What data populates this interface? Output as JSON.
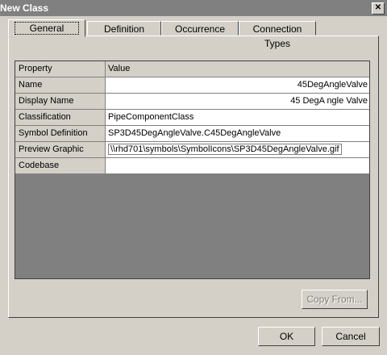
{
  "window": {
    "title": "New Class",
    "close_icon": "close-icon"
  },
  "tabs": [
    {
      "label": "General",
      "active": true
    },
    {
      "label": "Definition",
      "active": false
    },
    {
      "label": "Occurrence",
      "active": false
    },
    {
      "label": "Connection Types",
      "active": false
    }
  ],
  "grid": {
    "header": {
      "property": "Property",
      "value": "Value"
    },
    "rows": [
      {
        "property": "Name",
        "value": "45DegAngleValve"
      },
      {
        "property": "Display Name",
        "value": "45 DegA ngle Valve"
      },
      {
        "property": "Classification",
        "value": "PipeComponentClass"
      },
      {
        "property": "Symbol Definition",
        "value": "SP3D45DegAngleValve.C45DegAngleValve"
      },
      {
        "property": "Preview Graphic",
        "value": "\\\\rhd701\\symbols\\SymbolIcons\\SP3D45DegAngleValve.gif"
      },
      {
        "property": "Codebase",
        "value": ""
      }
    ]
  },
  "buttons": {
    "copy_from": "Copy From...",
    "ok": "OK",
    "cancel": "Cancel"
  }
}
